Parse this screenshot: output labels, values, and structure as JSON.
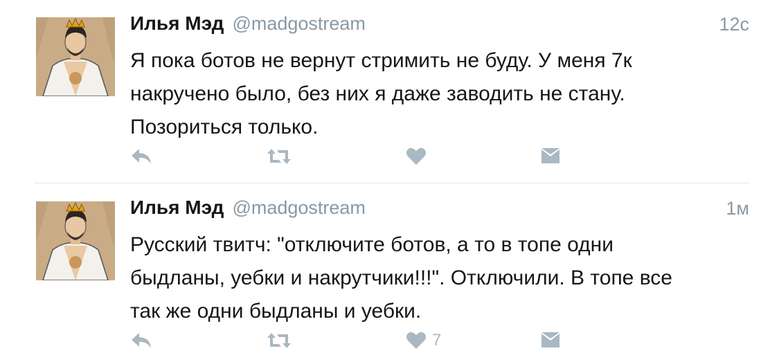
{
  "tweets": [
    {
      "author": "Илья Мэд",
      "handle": "@madgostream",
      "time": "12с",
      "lines": [
        "Я пока ботов не вернут стримить не буду. У меня 7к",
        "накручено было, без них я даже заводить не стану.",
        "Позориться только."
      ],
      "likes": ""
    },
    {
      "author": "Илья Мэд",
      "handle": "@madgostream",
      "time": "1м",
      "lines": [
        "Русский твитч: \"отключите ботов, а то в топе одни",
        "быдланы, уебки и накрутчики!!!\". Отключили. В топе все",
        "так же одни быдланы и уебки."
      ],
      "likes": "7"
    }
  ],
  "icons": {
    "reply": "reply-icon",
    "retweet": "retweet-icon",
    "like": "heart-icon",
    "dm": "direct-message-icon"
  },
  "colors": {
    "text": "#14171a",
    "secondary": "#8899a6",
    "action": "#aab8c2",
    "divider": "#e1e8ed"
  }
}
